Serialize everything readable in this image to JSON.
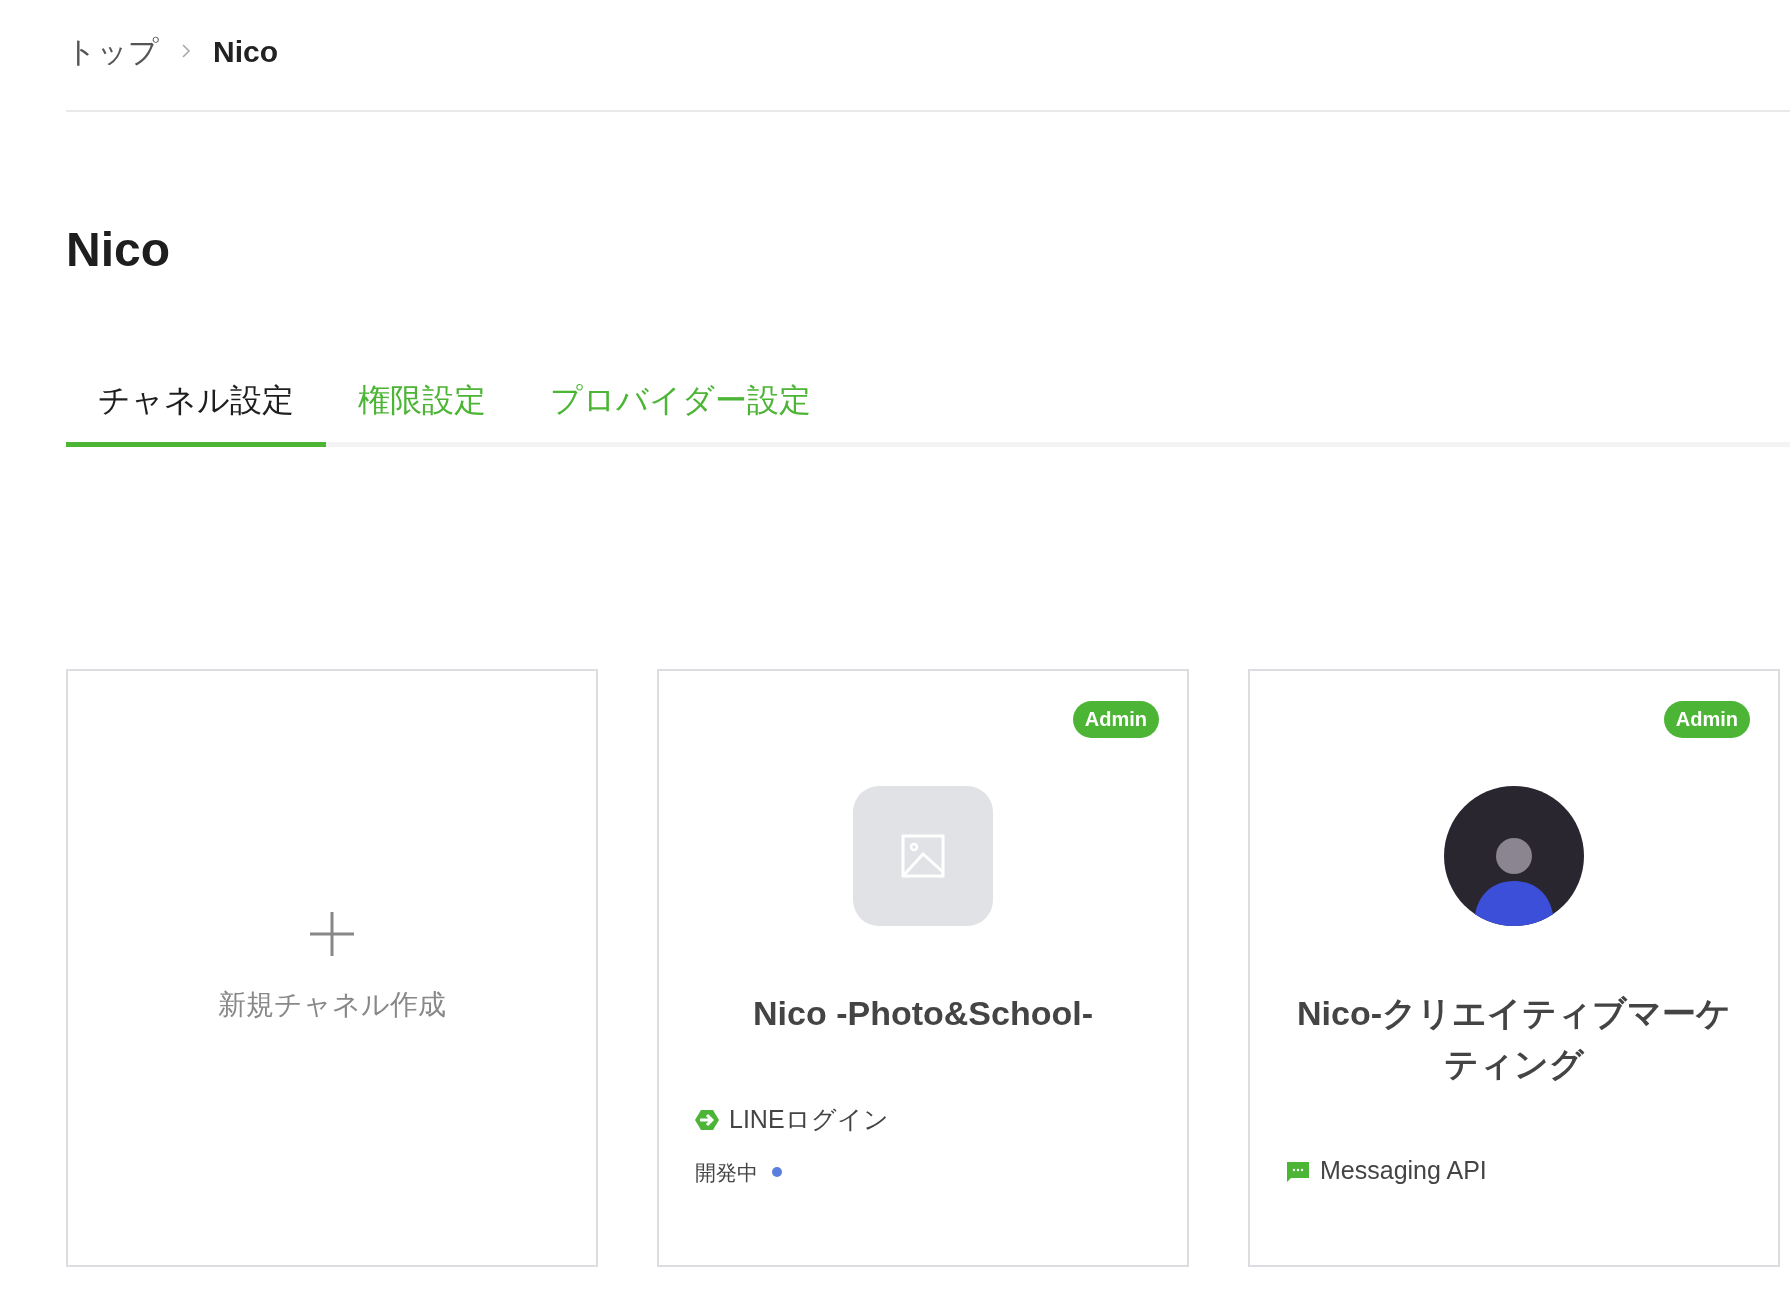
{
  "breadcrumb": [
    {
      "label": "トップ",
      "kind": "link"
    },
    {
      "label": "Nico",
      "kind": "current"
    }
  ],
  "title": "Nico",
  "tabs": [
    {
      "label": "チャネル設定",
      "selected": true
    },
    {
      "label": "権限設定",
      "selected": false
    },
    {
      "label": "プロバイダー設定",
      "selected": false
    }
  ],
  "new_channel": {
    "label": "新規チャネル作成"
  },
  "channels": [
    {
      "name": "Nico -Photo&School-",
      "badge": "Admin",
      "kind": "placeholder",
      "type": {
        "kind": "line_login",
        "label": "LINEログイン"
      },
      "status": {
        "label": "開発中",
        "color": "#5b7fdd"
      }
    },
    {
      "name": "Nico-クリエイティブマーケティング",
      "badge": "Admin",
      "kind": "photo",
      "type": {
        "kind": "messaging_api",
        "label": "Messaging API"
      }
    }
  ]
}
